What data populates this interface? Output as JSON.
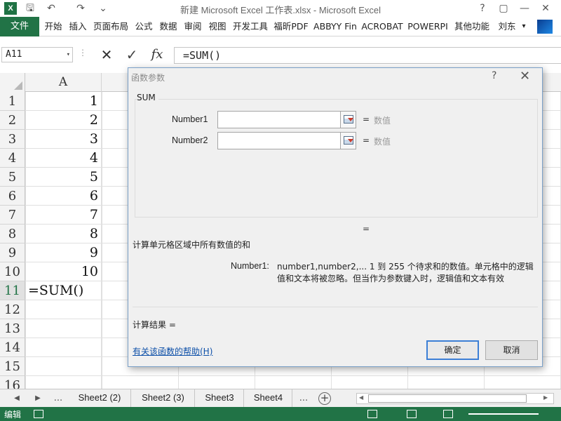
{
  "window": {
    "title": "新建 Microsoft Excel 工作表.xlsx - Microsoft Excel",
    "logo_text": "X",
    "help_glyph": "?",
    "restore_glyph": "▢",
    "minimize_glyph": "—",
    "close_glyph": "✕"
  },
  "quick_access": {
    "save_glyph": "🖫",
    "undo_glyph": "↶",
    "redo_glyph": "↷",
    "more_glyph": "⌄"
  },
  "ribbon": {
    "file_tab": "文件",
    "tabs": [
      "开始",
      "插入",
      "页面布局",
      "公式",
      "数据",
      "审阅",
      "视图",
      "开发工具",
      "福昕PDF",
      "ABBYY Fin",
      "ACROBAT",
      "POWERPI",
      "其他功能"
    ],
    "user": "刘东",
    "user_dropdown": "▾"
  },
  "formula_bar": {
    "name_box": "A11",
    "name_box_dropdown": "▾",
    "dots": "⋮",
    "cancel_glyph": "✕",
    "enter_glyph": "✓",
    "fx_glyph": "fx",
    "formula": "=SUM()"
  },
  "grid": {
    "column_headers": [
      "A"
    ],
    "rows": [
      {
        "num": "1",
        "a": "1"
      },
      {
        "num": "2",
        "a": "2"
      },
      {
        "num": "3",
        "a": "3"
      },
      {
        "num": "4",
        "a": "4"
      },
      {
        "num": "5",
        "a": "5"
      },
      {
        "num": "6",
        "a": "6"
      },
      {
        "num": "7",
        "a": "7"
      },
      {
        "num": "8",
        "a": "8"
      },
      {
        "num": "9",
        "a": "9"
      },
      {
        "num": "10",
        "a": "10"
      },
      {
        "num": "11",
        "a": "=SUM()"
      },
      {
        "num": "12",
        "a": ""
      },
      {
        "num": "13",
        "a": ""
      },
      {
        "num": "14",
        "a": ""
      },
      {
        "num": "15",
        "a": ""
      },
      {
        "num": "16",
        "a": ""
      }
    ]
  },
  "sheets": {
    "prev_glyph": "◀",
    "next_glyph": "▶",
    "ellipsis_left": "...",
    "tabs": [
      "Sheet2 (2)",
      "Sheet2 (3)",
      "Sheet3",
      "Sheet4"
    ],
    "ellipsis_right": "...",
    "add_glyph": "+",
    "scroll_left": "◀",
    "scroll_right": "▶"
  },
  "status": {
    "mode": "编辑"
  },
  "dialog": {
    "title": "函数参数",
    "help_glyph": "?",
    "close_glyph": "✕",
    "function_name": "SUM",
    "args": [
      {
        "label": "Number1",
        "value": "",
        "eq": "=",
        "type": "数值"
      },
      {
        "label": "Number2",
        "value": "",
        "eq": "=",
        "type": "数值"
      }
    ],
    "result_eq": "=",
    "description": "计算单元格区域中所有数值的和",
    "arg_label": "Number1:",
    "arg_description": "number1,number2,...  1 到 255 个待求和的数值。单元格中的逻辑值和文本将被忽略。但当作为参数键入时，逻辑值和文本有效",
    "result_label": "计算结果 =",
    "help_link": "有关该函数的帮助(H)",
    "ok": "确定",
    "cancel": "取消"
  }
}
